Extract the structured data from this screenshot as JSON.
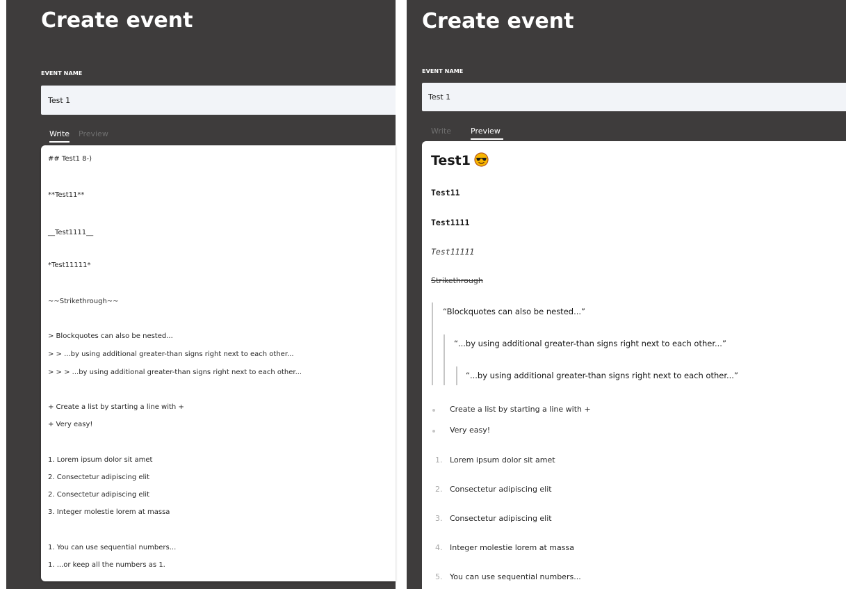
{
  "left": {
    "title": "Create event",
    "field_label": "EVENT NAME",
    "event_name": "Test 1",
    "tabs": {
      "write": "Write",
      "preview": "Preview"
    },
    "editor_lines": [
      "## Test1 8-)",
      "**Test11**",
      "__Test1111__",
      "*Test11111*",
      "~~Strikethrough~~",
      "> Blockquotes can also be nested...",
      "> > ...by using additional greater-than signs right next to each other...",
      "> > > ...by using additional greater-than signs right next to each other...",
      "+ Create a list by starting a line with +",
      "+ Very easy!",
      "1. Lorem ipsum dolor sit amet",
      "2. Consectetur adipiscing elit",
      "2. Consectetur adipiscing elit",
      "3. Integer molestie lorem at massa",
      "1. You can use sequential numbers...",
      "1. ...or keep all the numbers as 1."
    ]
  },
  "right": {
    "title": "Create event",
    "field_label": "EVENT NAME",
    "event_name": "Test 1",
    "tabs": {
      "write": "Write",
      "preview": "Preview"
    },
    "preview": {
      "heading": "Test1",
      "heading_icon": "sunglasses-emoji-icon",
      "bold_1": "Test11",
      "bold_2": "Test1111",
      "italic": "Test11111",
      "strike": "Strikethrough",
      "quotes": [
        "“Blockquotes can also be nested...”",
        "“...by using additional greater-than signs right next to each other...”",
        "“...by using additional greater-than signs right next to each other...”"
      ],
      "bullets": [
        "Create a list by starting a line with +",
        "Very easy!"
      ],
      "ordered": [
        {
          "num": "1.",
          "text": "Lorem ipsum dolor sit amet"
        },
        {
          "num": "2.",
          "text": "Consectetur adipiscing elit"
        },
        {
          "num": "3.",
          "text": "Consectetur adipiscing elit"
        },
        {
          "num": "4.",
          "text": "Integer molestie lorem at massa"
        },
        {
          "num": "5.",
          "text": "You can use sequential numbers..."
        }
      ]
    }
  },
  "colors": {
    "panel_bg": "#3e3c3c",
    "input_bg": "#f2f4f8",
    "quote_bar": "#c6c6c6",
    "emoji_face": "#f7b500"
  }
}
